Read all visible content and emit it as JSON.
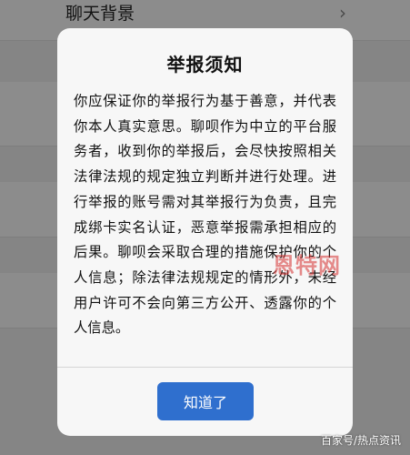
{
  "background": {
    "row_label": "聊天背景",
    "row_chevron": "›"
  },
  "dialog": {
    "title": "举报须知",
    "body": "你应保证你的举报行为基于善意，并代表你本人真实意思。聊呗作为中立的平台服务者，收到你的举报后，会尽快按照相关法律法规的规定独立判断并进行处理。进行举报的账号需对其举报行为负责，且完成绑卡实名认证，恶意举报需承担相应的后果。聊呗会采取合理的措施保护你的个人信息；除法律法规规定的情形外，未经用户许可不会向第三方公开、透露你的个人信息。",
    "confirm_label": "知道了"
  },
  "watermarks": {
    "brand": "恩特网",
    "source": "百家号/热点资讯"
  },
  "colors": {
    "accent": "#2f6fce",
    "overlay": "#000000",
    "dialog_bg": "#f7f7f7"
  }
}
